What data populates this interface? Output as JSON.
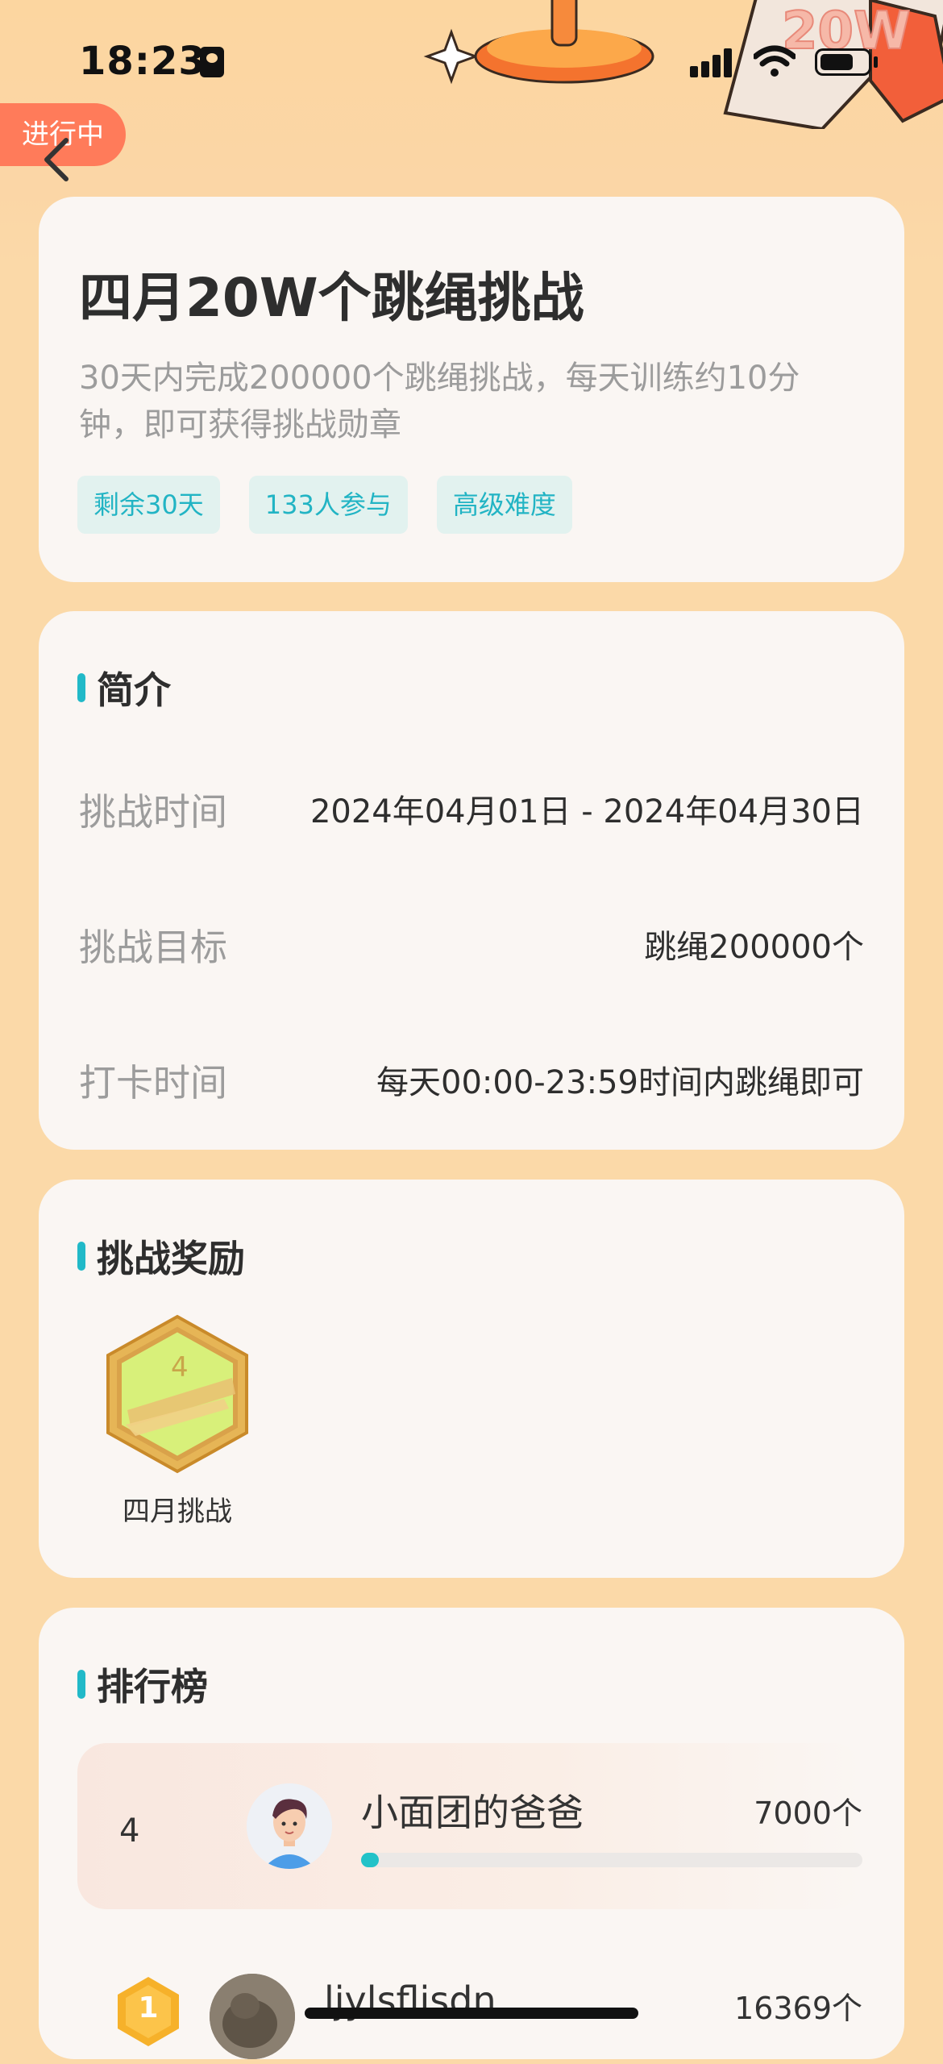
{
  "status_bar": {
    "time": "18:23"
  },
  "header": {
    "status_tag": "进行中"
  },
  "challenge": {
    "title": "四月20W个跳绳挑战",
    "description": "30天内完成200000个跳绳挑战，每天训练约10分钟，即可获得挑战勋章",
    "tags": [
      "剩余30天",
      "133人参与",
      "高级难度"
    ]
  },
  "intro": {
    "section_title": "简介",
    "rows": [
      {
        "label": "挑战时间",
        "value": "2024年04月01日 - 2024年04月30日"
      },
      {
        "label": "挑战目标",
        "value": "跳绳200000个"
      },
      {
        "label": "打卡时间",
        "value": "每天00:00-23:59时间内跳绳即可"
      }
    ]
  },
  "rewards": {
    "section_title": "挑战奖励",
    "medal_label": "四月挑战"
  },
  "leaderboard": {
    "section_title": "排行榜",
    "mine": {
      "rank": "4",
      "name": "小面团的爸爸",
      "count": "7000个",
      "progress": 0.035
    },
    "entries": [
      {
        "rank": "1",
        "name": "ljylsflisdn",
        "count": "16369个"
      }
    ]
  },
  "colors": {
    "accent": "#21b9c8",
    "status": "#ff7b5a",
    "background": "#fbd9a8",
    "card": "#faf6f3"
  },
  "icons": [
    "back-arrow-icon",
    "signal-icon",
    "wifi-icon",
    "battery-icon",
    "medal-icon",
    "gold-badge-icon"
  ]
}
